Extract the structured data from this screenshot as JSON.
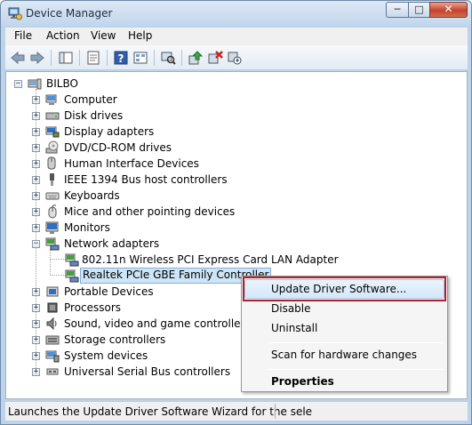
{
  "window": {
    "title": "Device Manager"
  },
  "menubar": {
    "items": [
      "File",
      "Action",
      "View",
      "Help"
    ]
  },
  "toolbar": {
    "buttons": [
      {
        "icon": "back-arrow-icon"
      },
      {
        "icon": "forward-arrow-icon"
      },
      {
        "icon": "show-hide-tree-icon"
      },
      {
        "icon": "properties-icon"
      },
      {
        "icon": "help-icon"
      },
      {
        "icon": "view-icon"
      },
      {
        "icon": "scan-hardware-icon"
      },
      {
        "icon": "update-driver-icon"
      },
      {
        "icon": "uninstall-icon"
      },
      {
        "icon": "disable-icon"
      }
    ]
  },
  "tree": {
    "root": "BILBO",
    "categories": [
      {
        "label": "Computer",
        "icon": "computer-icon"
      },
      {
        "label": "Disk drives",
        "icon": "disk-drive-icon"
      },
      {
        "label": "Display adapters",
        "icon": "display-adapter-icon"
      },
      {
        "label": "DVD/CD-ROM drives",
        "icon": "dvd-icon"
      },
      {
        "label": "Human Interface Devices",
        "icon": "hid-icon"
      },
      {
        "label": "IEEE 1394 Bus host controllers",
        "icon": "ieee1394-icon"
      },
      {
        "label": "Keyboards",
        "icon": "keyboard-icon"
      },
      {
        "label": "Mice and other pointing devices",
        "icon": "mouse-icon"
      },
      {
        "label": "Monitors",
        "icon": "monitor-icon"
      },
      {
        "label": "Network adapters",
        "icon": "network-adapter-icon",
        "expanded": true,
        "children": [
          {
            "label": "802.11n Wireless PCI Express Card LAN Adapter"
          },
          {
            "label": "Realtek PCIe GBE Family Controller",
            "selected": true
          }
        ]
      },
      {
        "label": "Portable Devices",
        "icon": "portable-device-icon"
      },
      {
        "label": "Processors",
        "icon": "processor-icon"
      },
      {
        "label": "Sound, video and game controllers",
        "icon": "sound-icon"
      },
      {
        "label": "Storage controllers",
        "icon": "storage-icon"
      },
      {
        "label": "System devices",
        "icon": "system-device-icon"
      },
      {
        "label": "Universal Serial Bus controllers",
        "icon": "usb-icon"
      }
    ]
  },
  "context_menu": {
    "items": [
      {
        "label": "Update Driver Software...",
        "highlighted": true
      },
      {
        "label": "Disable"
      },
      {
        "label": "Uninstall"
      },
      {
        "label": "Scan for hardware changes"
      },
      {
        "label": "Properties",
        "bold": true
      }
    ]
  },
  "statusbar": {
    "text": "Launches the Update Driver Software Wizard for the sele"
  },
  "colors": {
    "highlight_box": "#b0202a",
    "selection": "#cde6f7"
  }
}
